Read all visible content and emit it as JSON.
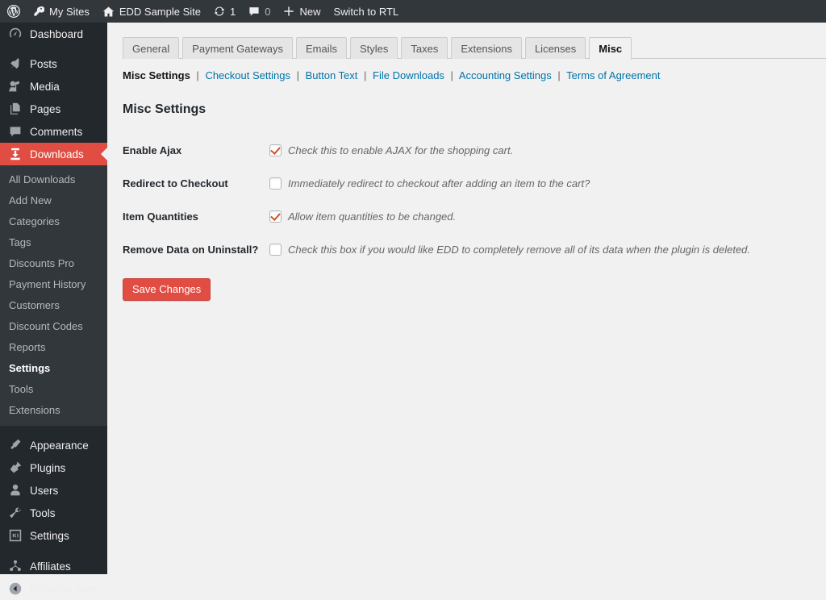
{
  "adminbar": {
    "wp_logo": "wordpress-logo",
    "items": [
      {
        "icon": "key-icon",
        "label": "My Sites"
      },
      {
        "icon": "home-icon",
        "label": "EDD Sample Site"
      },
      {
        "icon": "updates-icon",
        "label": "1"
      },
      {
        "icon": "comment-icon",
        "label": "0"
      },
      {
        "icon": "plus-icon",
        "label": "New"
      },
      {
        "icon": "",
        "label": "Switch to RTL"
      }
    ]
  },
  "sidebar": {
    "top_items": [
      {
        "label": "Dashboard",
        "icon": "dashboard-icon",
        "current": false
      },
      {
        "label": "Posts",
        "icon": "pin-icon",
        "current": false
      },
      {
        "label": "Media",
        "icon": "media-icon",
        "current": false
      },
      {
        "label": "Pages",
        "icon": "pages-icon",
        "current": false
      },
      {
        "label": "Comments",
        "icon": "comment-icon",
        "current": false
      },
      {
        "label": "Downloads",
        "icon": "download-icon",
        "current": true
      }
    ],
    "submenu": [
      {
        "label": "All Downloads",
        "active": false
      },
      {
        "label": "Add New",
        "active": false
      },
      {
        "label": "Categories",
        "active": false
      },
      {
        "label": "Tags",
        "active": false
      },
      {
        "label": "Discounts Pro",
        "active": false
      },
      {
        "label": "Payment History",
        "active": false
      },
      {
        "label": "Customers",
        "active": false
      },
      {
        "label": "Discount Codes",
        "active": false
      },
      {
        "label": "Reports",
        "active": false
      },
      {
        "label": "Settings",
        "active": true
      },
      {
        "label": "Tools",
        "active": false
      },
      {
        "label": "Extensions",
        "active": false
      }
    ],
    "bottom_items": [
      {
        "label": "Appearance",
        "icon": "appearance-icon"
      },
      {
        "label": "Plugins",
        "icon": "plugins-icon"
      },
      {
        "label": "Users",
        "icon": "users-icon"
      },
      {
        "label": "Tools",
        "icon": "tools-icon"
      },
      {
        "label": "Settings",
        "icon": "settings-icon"
      }
    ],
    "extra_items": [
      {
        "label": "Affiliates",
        "icon": "affiliates-icon"
      }
    ],
    "collapse": {
      "label": "Collapse menu",
      "icon": "collapse-icon"
    }
  },
  "tabs": [
    {
      "label": "General",
      "active": false
    },
    {
      "label": "Payment Gateways",
      "active": false
    },
    {
      "label": "Emails",
      "active": false
    },
    {
      "label": "Styles",
      "active": false
    },
    {
      "label": "Taxes",
      "active": false
    },
    {
      "label": "Extensions",
      "active": false
    },
    {
      "label": "Licenses",
      "active": false
    },
    {
      "label": "Misc",
      "active": true
    }
  ],
  "subnav": {
    "current": "Misc Settings",
    "separator": "|",
    "links": [
      "Checkout Settings",
      "Button Text",
      "File Downloads",
      "Accounting Settings",
      "Terms of Agreement"
    ]
  },
  "page": {
    "heading": "Misc Settings",
    "save_label": "Save Changes"
  },
  "settings": [
    {
      "label": "Enable Ajax",
      "description": "Check this to enable AJAX for the shopping cart.",
      "checked": true
    },
    {
      "label": "Redirect to Checkout",
      "description": "Immediately redirect to checkout after adding an item to the cart?",
      "checked": false
    },
    {
      "label": "Item Quantities",
      "description": "Allow item quantities to be changed.",
      "checked": true
    },
    {
      "label": "Remove Data on Uninstall?",
      "description": "Check this box if you would like EDD to completely remove all of its data when the plugin is deleted.",
      "checked": false
    }
  ],
  "colors": {
    "accent": "#e14d43",
    "adminbar_bg": "#32373c",
    "sidebar_bg": "#23282d",
    "submenu_bg": "#32373c",
    "link": "#0073aa",
    "content_bg": "#f1f1f1",
    "checkmark": "#d54e21"
  }
}
